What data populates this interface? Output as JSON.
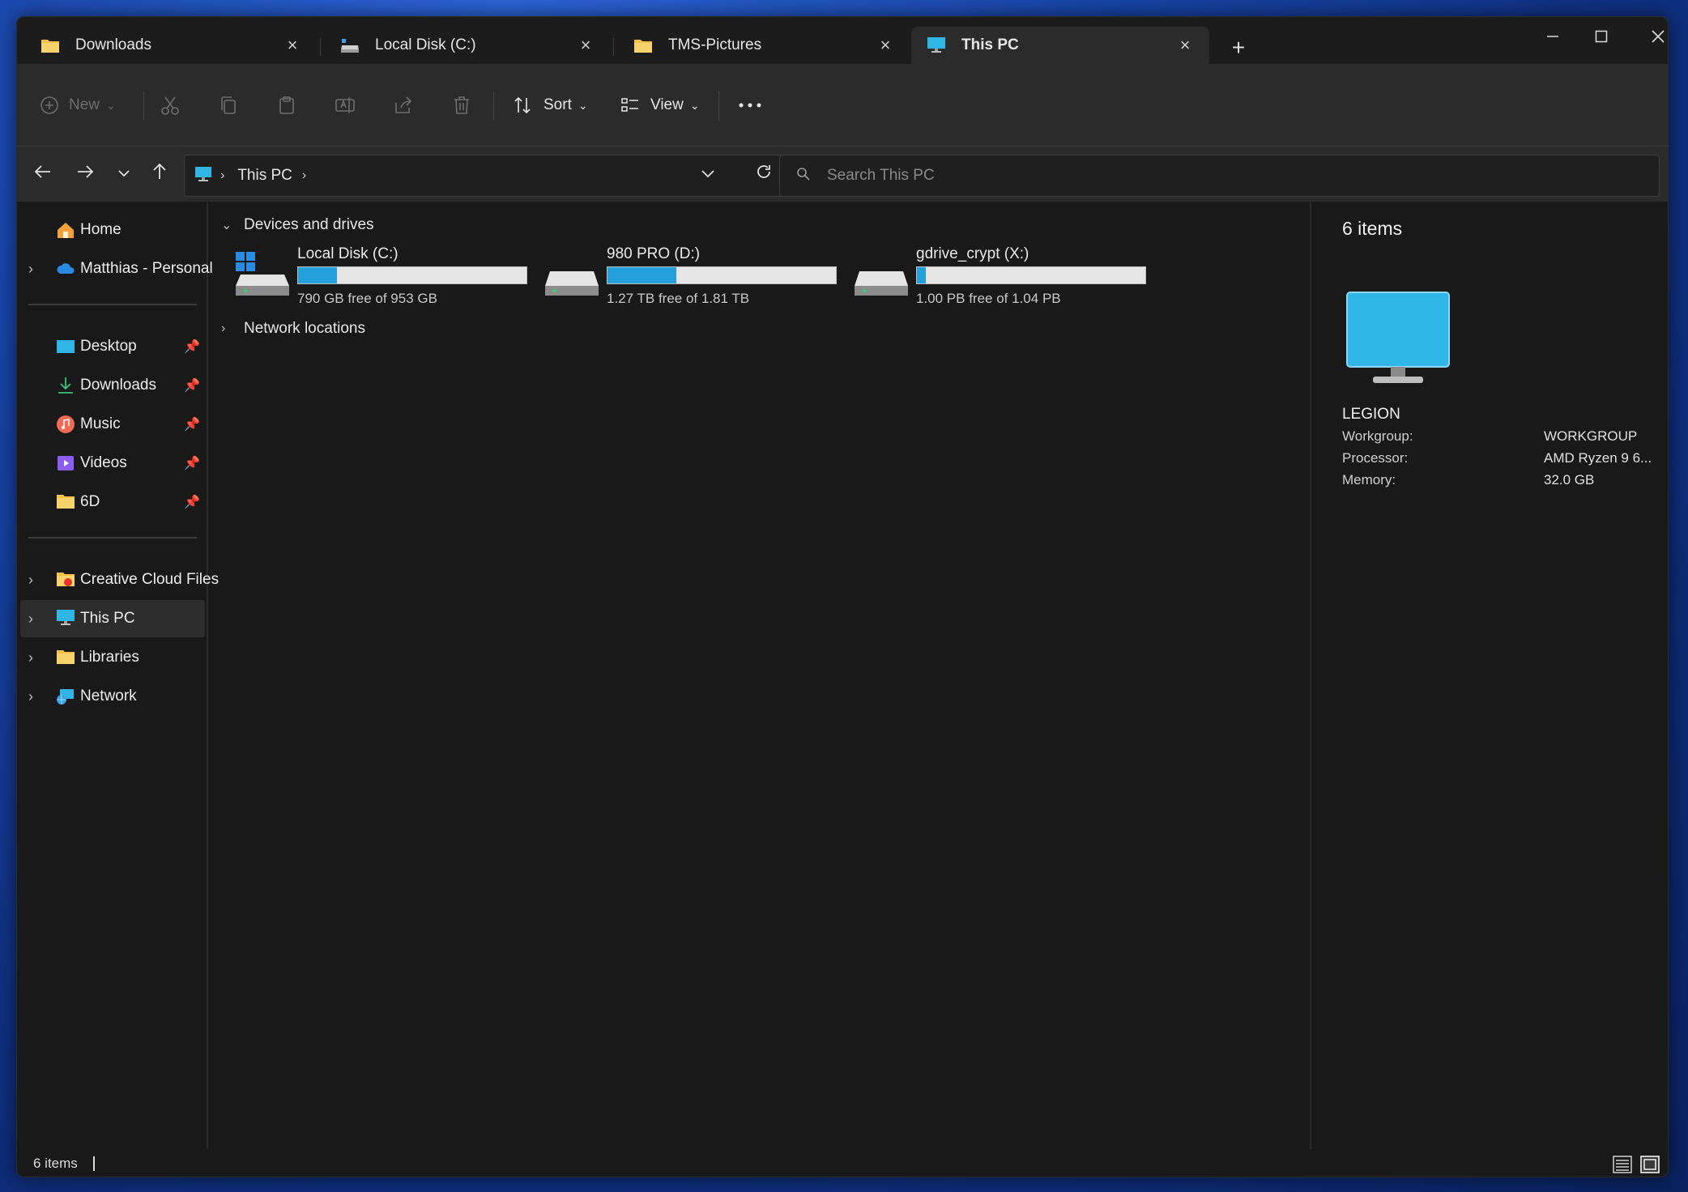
{
  "tabs": [
    {
      "label": "Downloads",
      "icon": "folder-icon"
    },
    {
      "label": "Local Disk (C:)",
      "icon": "drive-icon"
    },
    {
      "label": "TMS-Pictures",
      "icon": "folder-icon"
    },
    {
      "label": "This PC",
      "icon": "monitor-icon",
      "active": true
    }
  ],
  "toolbar": {
    "new_label": "New",
    "sort_label": "Sort",
    "view_label": "View"
  },
  "address": {
    "crumbs": [
      "This PC"
    ]
  },
  "search": {
    "placeholder": "Search This PC"
  },
  "sidebar": {
    "home": "Home",
    "onedrive": "Matthias - Personal",
    "quick": [
      "Desktop",
      "Downloads",
      "Music",
      "Videos",
      "6D"
    ],
    "tree": [
      "Creative Cloud Files",
      "This PC",
      "Libraries",
      "Network"
    ]
  },
  "groups": {
    "devices": "Devices and drives",
    "network": "Network locations"
  },
  "drives": [
    {
      "name": "Local Disk (C:)",
      "free": "790 GB free of 953 GB",
      "used_fraction": 0.17
    },
    {
      "name": "980 PRO (D:)",
      "free": "1.27 TB free of 1.81 TB",
      "used_fraction": 0.3
    },
    {
      "name": "gdrive_crypt (X:)",
      "free": "1.00 PB free of 1.04 PB",
      "used_fraction": 0.04
    }
  ],
  "details": {
    "count": "6 items",
    "pc_name": "LEGION",
    "props": [
      {
        "key": "Workgroup:",
        "value": "WORKGROUP"
      },
      {
        "key": "Processor:",
        "value": "AMD Ryzen 9 6..."
      },
      {
        "key": "Memory:",
        "value": "32.0 GB"
      }
    ]
  },
  "status": {
    "count": "6 items"
  },
  "colors": {
    "accent": "#26a0da",
    "background": "#191919",
    "toolbar": "#2b2b2b"
  }
}
